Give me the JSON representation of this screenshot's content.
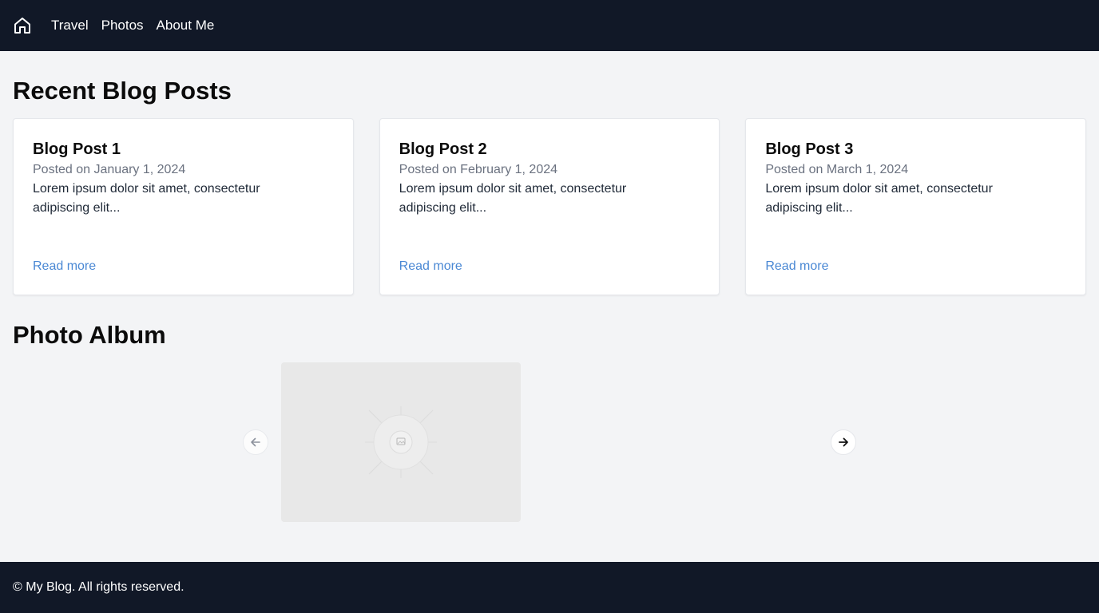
{
  "nav": {
    "home_icon": "home-icon",
    "links": [
      "Travel",
      "Photos",
      "About Me"
    ]
  },
  "blog": {
    "title": "Recent Blog Posts",
    "posts": [
      {
        "title": "Blog Post 1",
        "date": "Posted on January 1, 2024",
        "excerpt": "Lorem ipsum dolor sit amet, consectetur adipiscing elit...",
        "link": "Read more"
      },
      {
        "title": "Blog Post 2",
        "date": "Posted on February 1, 2024",
        "excerpt": "Lorem ipsum dolor sit amet, consectetur adipiscing elit...",
        "link": "Read more"
      },
      {
        "title": "Blog Post 3",
        "date": "Posted on March 1, 2024",
        "excerpt": "Lorem ipsum dolor sit amet, consectetur adipiscing elit...",
        "link": "Read more"
      }
    ]
  },
  "album": {
    "title": "Photo Album",
    "prev_icon": "arrow-left-icon",
    "next_icon": "arrow-right-icon",
    "photo_icon": "image-placeholder-icon"
  },
  "footer": {
    "text": "© My Blog. All rights reserved."
  },
  "colors": {
    "header_bg": "#111827",
    "page_bg": "#f3f4f6",
    "link": "#4a88d4",
    "muted": "#6b7280"
  }
}
